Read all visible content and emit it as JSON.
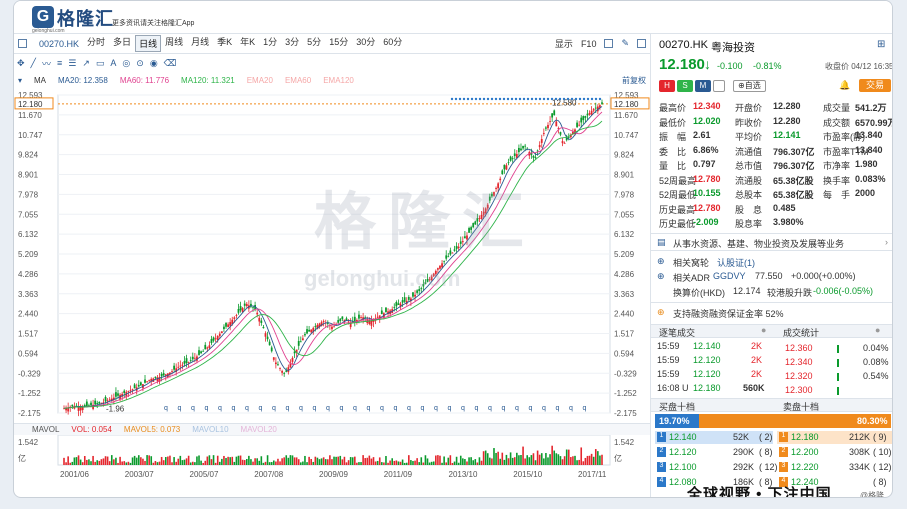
{
  "brand": {
    "logo_letter": "G",
    "name": "格隆汇",
    "domain": "gelonghui.com",
    "promo": "更多资讯请关注格隆汇App"
  },
  "toolbar": {
    "code": "00270.HK",
    "periods": [
      "分时",
      "多日",
      "日线",
      "周线",
      "月线",
      "季K",
      "年K",
      "1分",
      "3分",
      "5分",
      "15分",
      "30分",
      "60分"
    ],
    "active": "日线",
    "display": "显示",
    "f10": "F10"
  },
  "toolbar2": {
    "ma_label": "MA",
    "restore": "前复权"
  },
  "ma": {
    "ma20": "MA20: 12.358",
    "ma60": "MA60: 11.776",
    "ma120": "MA120: 11.321",
    "ema20": "EMA20",
    "ema60": "EMA60",
    "ema120": "EMA120"
  },
  "colors": {
    "ma20": "#2a5a92",
    "ma60": "#e0418f",
    "ma120": "#2fb44a",
    "candle_up": "#e4262d",
    "candle_down": "#0a9a2c"
  },
  "chart_data": {
    "type": "candlestick",
    "price_axis": [
      "12.593",
      "11.670",
      "10.747",
      "9.824",
      "8.901",
      "7.978",
      "7.055",
      "6.132",
      "5.209",
      "4.286",
      "3.363",
      "2.440",
      "1.517",
      "0.594",
      "-0.329",
      "-1.252",
      "-2.175"
    ],
    "current_price_label": "12.180",
    "high_marker": "12.580",
    "low_marker": "-1.96",
    "x_labels": [
      "2001/06",
      "2003/07",
      "2005/07",
      "2007/08",
      "2009/09",
      "2011/09",
      "2013/10",
      "2015/10",
      "2017/11"
    ],
    "close_series": [
      -1.96,
      -1.85,
      -1.9,
      -1.8,
      -1.7,
      -1.5,
      -1.3,
      -1.1,
      -0.9,
      -0.6,
      -0.5,
      -0.3,
      0.0,
      0.2,
      0.5,
      0.9,
      1.4,
      1.9,
      2.4,
      2.9,
      2.6,
      1.5,
      0.2,
      -0.4,
      0.6,
      1.4,
      1.8,
      2.1,
      1.8,
      2.2,
      2.0,
      2.3,
      2.1,
      2.4,
      2.6,
      2.9,
      3.1,
      3.5,
      4.0,
      4.6,
      5.1,
      5.5,
      6.1,
      6.7,
      7.4,
      8.3,
      9.3,
      9.8,
      10.2,
      9.6,
      10.9,
      11.7,
      10.3,
      10.9,
      11.4,
      11.9,
      12.18
    ],
    "vol_axis": [
      "1.542",
      "1.542"
    ],
    "vol_unit": "亿"
  },
  "vol_head": {
    "name": "MAVOL",
    "vol": "VOL: 0.054",
    "mavol5": "MAVOL5: 0.073",
    "mavol10": "MAVOL10",
    "mavol20": "MAVOL20"
  },
  "quote": {
    "code": "00270.HK",
    "name": "粤海投资",
    "price": "12.180",
    "arrow": "↓",
    "change": "-0.100",
    "pct": "-0.81%",
    "time": "收盘价 04/12 16:35",
    "trade": "交易",
    "watch": "自选",
    "stats": [
      [
        "最高价",
        "12.340",
        "开盘价",
        "12.280",
        "成交量",
        "541.2万"
      ],
      [
        "最低价",
        "12.020",
        "昨收价",
        "12.280",
        "成交额",
        "6570.99万"
      ],
      [
        "振　幅",
        "2.61",
        "平均价",
        "12.141",
        "市盈率(静)",
        "13.840"
      ],
      [
        "委　比",
        "6.86%",
        "流通值",
        "796.307亿",
        "市盈率TTM",
        "13.840"
      ],
      [
        "量　比",
        "0.797",
        "总市值",
        "796.307亿",
        "市净率",
        "1.980"
      ],
      [
        "52周最高",
        "12.780",
        "流通股",
        "65.38亿股",
        "换手率",
        "0.083%"
      ],
      [
        "52周最低",
        "10.155",
        "总股本",
        "65.38亿股",
        "每　手",
        "2000"
      ],
      [
        "历史最高",
        "12.780",
        "股　息",
        "0.485",
        "",
        ""
      ],
      [
        "历史最低",
        "-2.009",
        "股息率",
        "3.980%",
        "",
        ""
      ]
    ],
    "business": "从事水资源、基建、物业投资及发展等业务",
    "warrant": "相关窝轮",
    "cbbc": "认股证(1)",
    "adr_label": "相关ADR",
    "adr_code": "GGDVY",
    "adr_price": "77.550",
    "adr_chg": "+0.000(+0.00%)",
    "hk_conv": "换算价(HKD)",
    "hk_price": "12.174",
    "hk_prem": "较港股升跌",
    "hk_prem_val": "-0.006(-0.05%)",
    "margin": "支持融资",
    "margin_ratio": "融资保证金率 52%"
  },
  "ticks": {
    "title": "逐笔成交",
    "rows": [
      [
        "15:59",
        "12.140",
        "2K"
      ],
      [
        "15:59",
        "12.120",
        "2K"
      ],
      [
        "15:59",
        "12.120",
        "2K"
      ],
      [
        "16:08 U",
        "12.180",
        "560K"
      ]
    ]
  },
  "dist": {
    "title": "成交统计",
    "rows": [
      [
        "12.360",
        "0.04%"
      ],
      [
        "12.340",
        "0.08%"
      ],
      [
        "12.320",
        "0.54%"
      ],
      [
        "12.300",
        ""
      ]
    ]
  },
  "book": {
    "buy_title": "买盘十档",
    "sell_title": "卖盘十档",
    "buy_pct": "19.70%",
    "sell_pct": "80.30%",
    "buy": [
      [
        "1",
        "12.140",
        "52K",
        "2"
      ],
      [
        "2",
        "12.120",
        "290K",
        "8"
      ],
      [
        "3",
        "12.100",
        "292K",
        "12"
      ],
      [
        "4",
        "12.080",
        "186K",
        "8"
      ]
    ],
    "sell": [
      [
        "1",
        "12.180",
        "212K",
        "9"
      ],
      [
        "2",
        "12.200",
        "308K",
        "10"
      ],
      [
        "3",
        "12.220",
        "334K",
        "12"
      ],
      [
        "4",
        "12.240",
        "",
        "8"
      ]
    ]
  },
  "footer": {
    "slogan": "全球视野 • 下注中国",
    "mark": "@格隆汇"
  },
  "watermark": {
    "text": "格隆汇",
    "url": "gelonghui.com"
  }
}
